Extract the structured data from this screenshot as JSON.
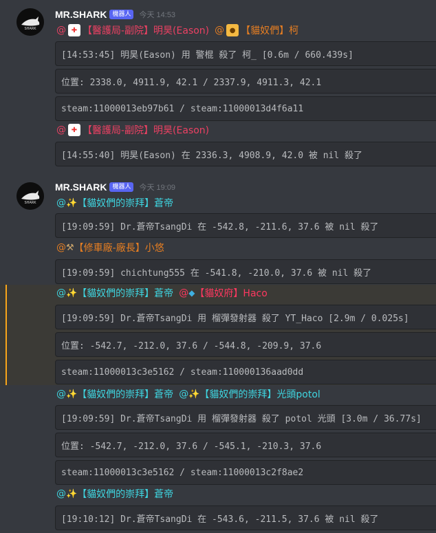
{
  "messages": [
    {
      "author": "MR.SHARK",
      "bot_tag": "機器人",
      "time": "今天 14:53",
      "mention1_prefix": "@",
      "mention1_icon": "ambulance-icon",
      "mention1_text": "【醫護局-副院】明昊(Eason)",
      "mention2_prefix": "@",
      "mention2_icon": "cat-icon",
      "mention2_text": "【貓奴們】柯",
      "code1": "[14:53:45] 明昊(Eason) 用 警棍 殺了 柯_ [0.6m / 660.439s]",
      "code2": "位置: 2338.0, 4911.9, 42.1 / 2337.9, 4911.3, 42.1",
      "code3": "steam:11000013eb97b61 / steam:11000013d4f6a11",
      "mention3_prefix": "@",
      "mention3_text": "【醫護局-副院】明昊(Eason)",
      "code4": "[14:55:40] 明昊(Eason) 在 2336.3, 4908.9, 42.0 被 nil 殺了"
    },
    {
      "author": "MR.SHARK",
      "bot_tag": "機器人",
      "time": "今天 19:09",
      "m1": "【貓奴們的崇拜】蒼帝",
      "c1": "[19:09:59] Dr.蒼帝TsangDi 在 -542.8, -211.6, 37.6 被 nil 殺了",
      "m2": "【修車廠-廠長】小悠",
      "c2": "[19:09:59] chichtung555 在 -541.8, -210.0, 37.6 被 nil 殺了",
      "m3a": "【貓奴們的崇拜】蒼帝",
      "m3b": "【貓奴府】Haco",
      "c3": "[19:09:59] Dr.蒼帝TsangDi 用 榴彈發射器 殺了 YT_Haco [2.9m / 0.025s]",
      "c4": "位置: -542.7, -212.0, 37.6 / -544.8, -209.9, 37.6",
      "c5": "steam:11000013c3e5162 / steam:110000136aad0dd",
      "m4a": "【貓奴們的崇拜】蒼帝",
      "m4b": "【貓奴們的崇拜】光頭potol",
      "c6": "[19:09:59] Dr.蒼帝TsangDi 用 榴彈發射器 殺了 potol 光頭 [3.0m / 36.77s]",
      "c7": "位置: -542.7, -212.0, 37.6 / -545.1, -210.3, 37.6",
      "c8": "steam:11000013c3e5162 / steam:11000013c2f8ae2",
      "m5": "【貓奴們的崇拜】蒼帝",
      "c9": "[19:10:12] Dr.蒼帝TsangDi 在 -543.6, -211.5, 37.6 被 nil 殺了"
    }
  ],
  "at": "@",
  "colors": {
    "bg": "#36393f",
    "code_bg": "#2f3136",
    "highlight": "#faa61a"
  }
}
